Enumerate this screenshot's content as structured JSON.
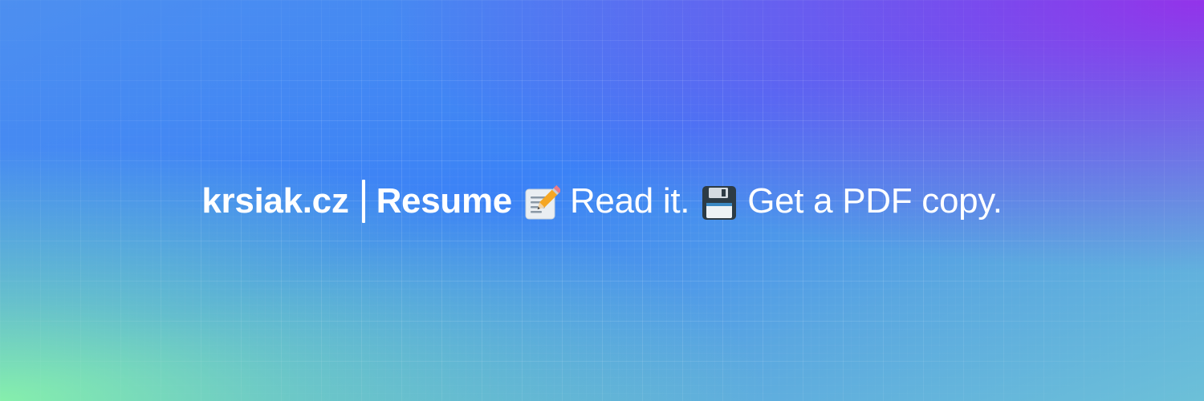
{
  "banner": {
    "site_name": "krsiak.cz",
    "page_name": "Resume",
    "read_text": "Read it.",
    "pdf_text": "Get a PDF copy.",
    "icons": [
      "memo-icon",
      "floppy-disk-icon"
    ]
  },
  "colors": {
    "text": "#ffffff",
    "gradient_blue": "#3b82f6",
    "gradient_purple": "#9333ea",
    "gradient_green": "#86efac"
  }
}
